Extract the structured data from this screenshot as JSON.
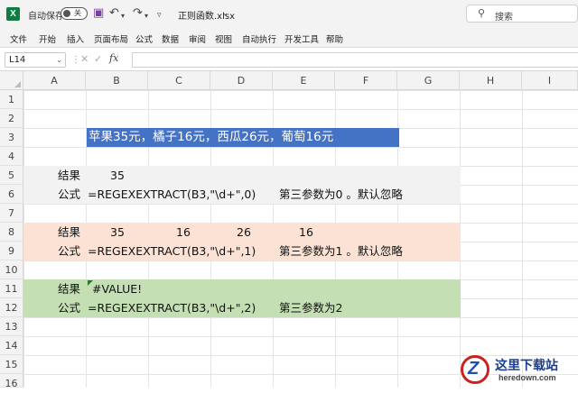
{
  "titlebar": {
    "app_icon": "excel-logo",
    "app_letter": "X",
    "autosave_label": "自动保存",
    "autosave_state": "关",
    "doc_title": "正则函数.xlsx",
    "search_label": "搜索"
  },
  "menu": [
    "文件",
    "开始",
    "插入",
    "页面布局",
    "公式",
    "数据",
    "审阅",
    "视图",
    "自动执行",
    "开发工具",
    "帮助"
  ],
  "formula_bar": {
    "name_box": "L14",
    "fx": "fx",
    "formula": ""
  },
  "columns": [
    "A",
    "B",
    "C",
    "D",
    "E",
    "F",
    "G",
    "H",
    "I"
  ],
  "rows": [
    "1",
    "2",
    "3",
    "4",
    "5",
    "6",
    "7",
    "8",
    "9",
    "10",
    "11",
    "12",
    "13",
    "14",
    "15",
    "16"
  ],
  "cells": {
    "b3": "苹果35元，橘子16元，西瓜26元，葡萄16元",
    "r5_label": "结果",
    "r5_b": "35",
    "r6_label": "公式",
    "r6_formula": "=REGEXEXTRACT(B3,\"\\d+\",0)",
    "r6_note": "第三参数为0 。默认忽略",
    "r8_label": "结果",
    "r8_b": "35",
    "r8_c": "16",
    "r8_d": "26",
    "r8_e": "16",
    "r9_label": "公式",
    "r9_formula": "=REGEXEXTRACT(B3,\"\\d+\",1)",
    "r9_note": "第三参数为1 。默认忽略",
    "r11_label": "结果",
    "r11_b": "#VALUE!",
    "r12_label": "公式",
    "r12_formula": "=REGEXEXTRACT(B3,\"\\d+\",2)",
    "r12_note": "第三参数为2"
  },
  "colors": {
    "title_fill": "#4472c4",
    "band_gray": "#f2f2f2",
    "band_peach": "#fbe2d5",
    "band_green": "#c5dfb4"
  },
  "watermark": {
    "text": "这里下载站",
    "url": "heredown.com",
    "logo_letter": "Z"
  }
}
